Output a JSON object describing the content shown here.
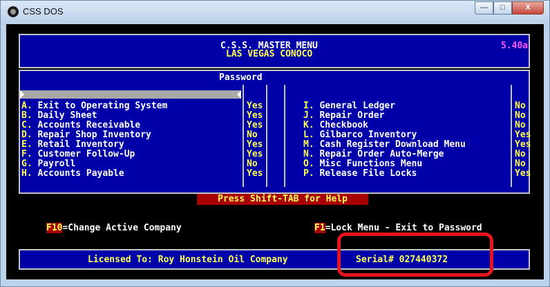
{
  "window": {
    "title": "CSS DOS",
    "min_label": "—",
    "max_label": "□",
    "close_label": "X"
  },
  "header": {
    "title": "C.S.S. MASTER MENU",
    "company": "LAS VEGAS CONOCO",
    "version": "5.40a"
  },
  "password_label": "Password",
  "left_items": [
    {
      "key": "A.",
      "label": "Exit to Operating System",
      "value": "Yes"
    },
    {
      "key": "B.",
      "label": "Daily Sheet",
      "value": "Yes"
    },
    {
      "key": "C.",
      "label": "Accounts Receivable",
      "value": "Yes"
    },
    {
      "key": "D.",
      "label": "Repair Shop Inventory",
      "value": "No"
    },
    {
      "key": "E.",
      "label": "Retail Inventory",
      "value": "Yes"
    },
    {
      "key": "F.",
      "label": "Customer Follow-Up",
      "value": "Yes"
    },
    {
      "key": "G.",
      "label": "Payroll",
      "value": "No"
    },
    {
      "key": "H.",
      "label": "Accounts Payable",
      "value": "Yes"
    }
  ],
  "right_items": [
    {
      "key": "I.",
      "label": "General Ledger",
      "value": "No"
    },
    {
      "key": "J.",
      "label": "Repair Order",
      "value": "No"
    },
    {
      "key": "K.",
      "label": "Checkbook",
      "value": "No"
    },
    {
      "key": "L.",
      "label": "Gilbarco Inventory",
      "value": "Yes"
    },
    {
      "key": "M.",
      "label": "Cash Register Download Menu",
      "value": "Yes"
    },
    {
      "key": "N.",
      "label": "Repair Order Auto-Merge",
      "value": "No"
    },
    {
      "key": "O.",
      "label": "Misc Functions Menu",
      "value": "No"
    },
    {
      "key": "P.",
      "label": "Release File Locks",
      "value": "Yes"
    }
  ],
  "help_text": "Press Shift-TAB for Help",
  "f10": {
    "key": "F10",
    "label": "=Change Active Company"
  },
  "f1": {
    "key": "F1",
    "label": "=Lock Menu - Exit to Password"
  },
  "license": {
    "text": "Licensed To: Roy Honstein Oil Company",
    "serial": "Serial# 027440372"
  }
}
